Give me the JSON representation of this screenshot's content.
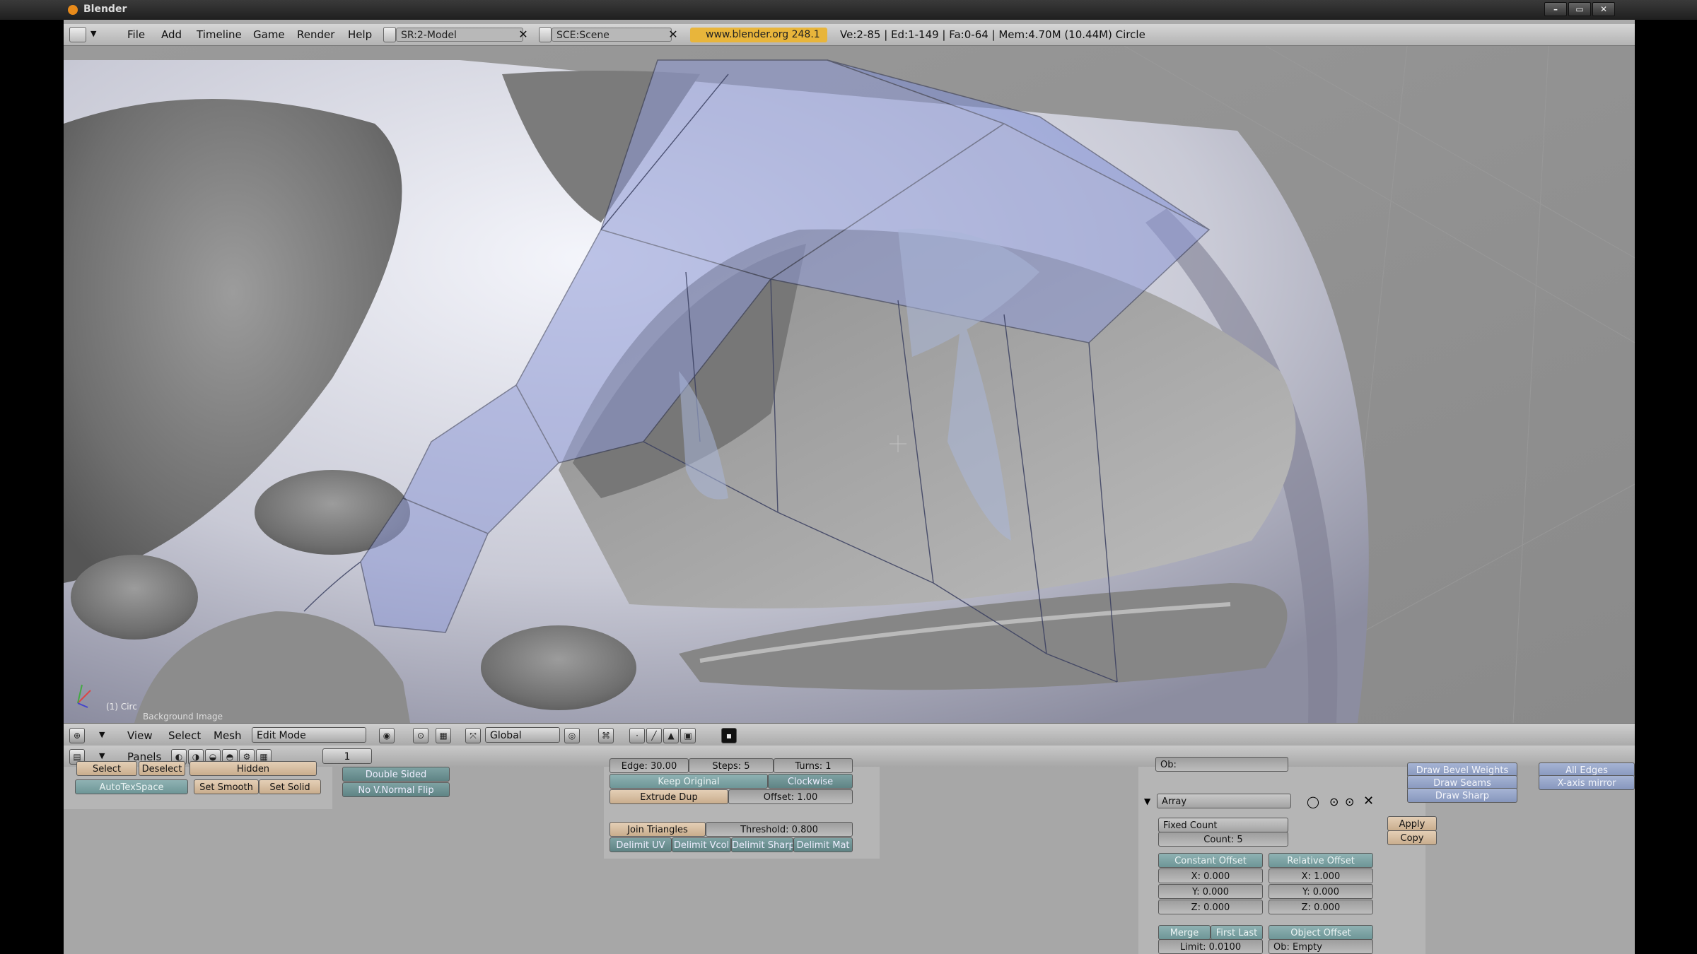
{
  "window": {
    "title": "Blender",
    "buttons": [
      "–",
      "▭",
      "✕"
    ]
  },
  "info_header": {
    "menus": [
      "File",
      "Add",
      "Timeline",
      "Game",
      "Render",
      "Help"
    ],
    "screen": "SR:2-Model",
    "scene": "SCE:Scene",
    "url": "www.blender.org 248.1",
    "stats": "Ve:2-85 | Ed:1-149 | Fa:0-64 | Mem:4.70M (10.44M) Circle"
  },
  "viewport": {
    "object_label": "(1) Circ",
    "background_label": "Background Image"
  },
  "header_3d": {
    "menus": [
      "View",
      "Select",
      "Mesh"
    ],
    "mode": "Edit Mode",
    "orientation": "Global"
  },
  "buttons_header": {
    "panels_label": "Panels",
    "frame": "1"
  },
  "mesh_tools": {
    "select": "Select",
    "deselect": "Deselect",
    "hidden": "Hidden",
    "auto_tex_space": "AutoTexSpace",
    "set_smooth": "Set Smooth",
    "set_solid": "Set Solid",
    "double_sided": "Double Sided",
    "no_v_normal_flip": "No V.Normal Flip"
  },
  "mesh_tools2": {
    "row_top": [
      "Edge: 30.00",
      "Steps: 5",
      "Turns: 1"
    ],
    "keep_original": "Keep Original",
    "clockwise": "Clockwise",
    "extrude_dup": "Extrude Dup",
    "offset": "Offset: 1.00",
    "join_triangles": "Join Triangles",
    "threshold": "Threshold: 0.800",
    "delimit": [
      "Delimit UV",
      "Delimit Vcol",
      "Delimit Sharp",
      "Delimit Mat"
    ]
  },
  "modifier": {
    "ob_field": "Ob:",
    "name": "Array",
    "fit_type": "Fixed Count",
    "count": "Count: 5",
    "apply": "Apply",
    "copy": "Copy",
    "constant_offset": "Constant Offset",
    "relative_offset": "Relative Offset",
    "constant_values": [
      "X: 0.000",
      "Y: 0.000",
      "Z: 0.000"
    ],
    "relative_values": [
      "X: 1.000",
      "Y: 0.000",
      "Z: 0.000"
    ],
    "merge": "Merge",
    "first_last": "First Last",
    "object_offset": "Object Offset",
    "limit": "Limit: 0.0100",
    "ob_empty": "Ob: Empty"
  },
  "draw_options": {
    "bevel_weights": "Draw Bevel Weights",
    "seams": "Draw Seams",
    "sharp": "Draw Sharp",
    "all_edges": "All Edges",
    "x_axis_mirror": "X-axis mirror"
  }
}
